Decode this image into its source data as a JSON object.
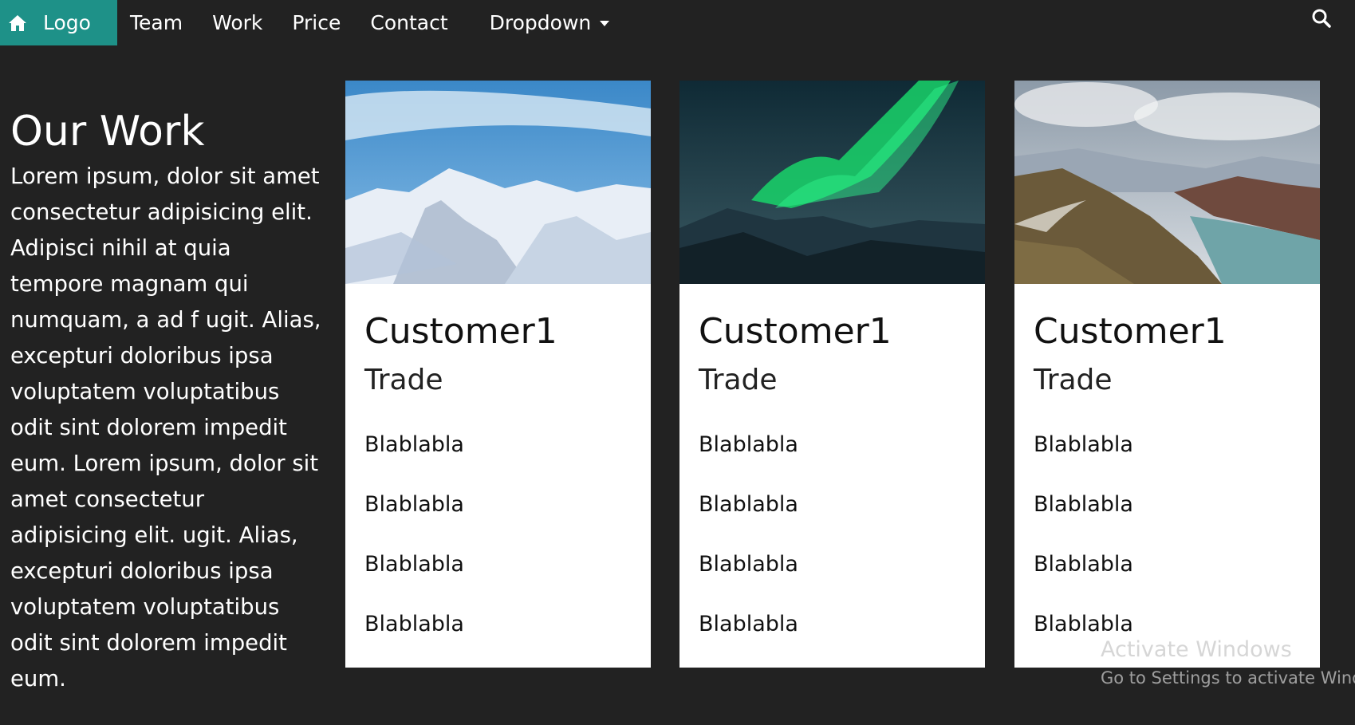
{
  "navbar": {
    "logo_label": "Logo",
    "links": [
      "Team",
      "Work",
      "Price",
      "Contact"
    ],
    "dropdown_label": "Dropdown",
    "brand_color": "#1e9188",
    "icons": {
      "home": "home-icon",
      "search": "search-icon",
      "caret": "caret-down-icon"
    }
  },
  "intro": {
    "title": "Our Work",
    "text": "Lorem ipsum, dolor sit amet consectetur adipisicing elit. Adipisci nihil at quia tempore magnam qui numquam, a ad f ugit. Alias, excepturi doloribus ipsa voluptatem voluptatibus odit sint dolorem impedit eum. Lorem ipsum, dolor sit amet consectetur adipisicing elit. ugit. Alias, excepturi doloribus ipsa voluptatem voluptatibus odit sint dolorem impedit eum."
  },
  "cards": [
    {
      "image": "snowy-mountains-photo",
      "title": "Customer1",
      "subtitle": "Trade",
      "items": [
        "Blablabla",
        "Blablabla",
        "Blablabla",
        "Blablabla"
      ]
    },
    {
      "image": "aurora-borealis-photo",
      "title": "Customer1",
      "subtitle": "Trade",
      "items": [
        "Blablabla",
        "Blablabla",
        "Blablabla",
        "Blablabla"
      ]
    },
    {
      "image": "mountain-lake-road-photo",
      "title": "Customer1",
      "subtitle": "Trade",
      "items": [
        "Blablabla",
        "Blablabla",
        "Blablabla",
        "Blablabla"
      ]
    }
  ],
  "watermark": {
    "line1": "Activate Windows",
    "line2": "Go to Settings to activate Windows."
  }
}
